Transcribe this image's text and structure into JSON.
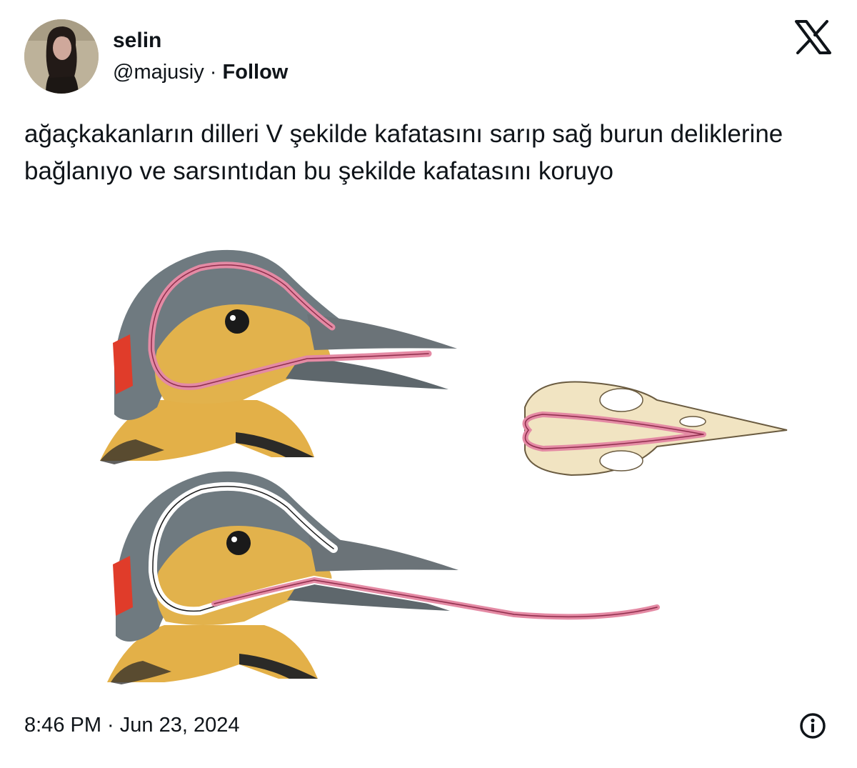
{
  "author": {
    "display_name": "selin",
    "handle": "@majusiy",
    "separator": " · ",
    "follow_label": "Follow",
    "avatar_icon": "profile-photo"
  },
  "tweet": {
    "text": "ağaçkakanların dilleri V şekilde kafatasını sarıp sağ burun deliklerine bağlanıyo ve sarsıntıdan bu şekilde kafatasını koruyo",
    "image_subject": "woodpecker-tongue-anatomy-illustration"
  },
  "footer": {
    "timestamp": "8:46 PM · Jun 23, 2024",
    "info_icon": "info-icon"
  },
  "brand": {
    "logo": "x-logo",
    "text_color": "#0f1419"
  }
}
